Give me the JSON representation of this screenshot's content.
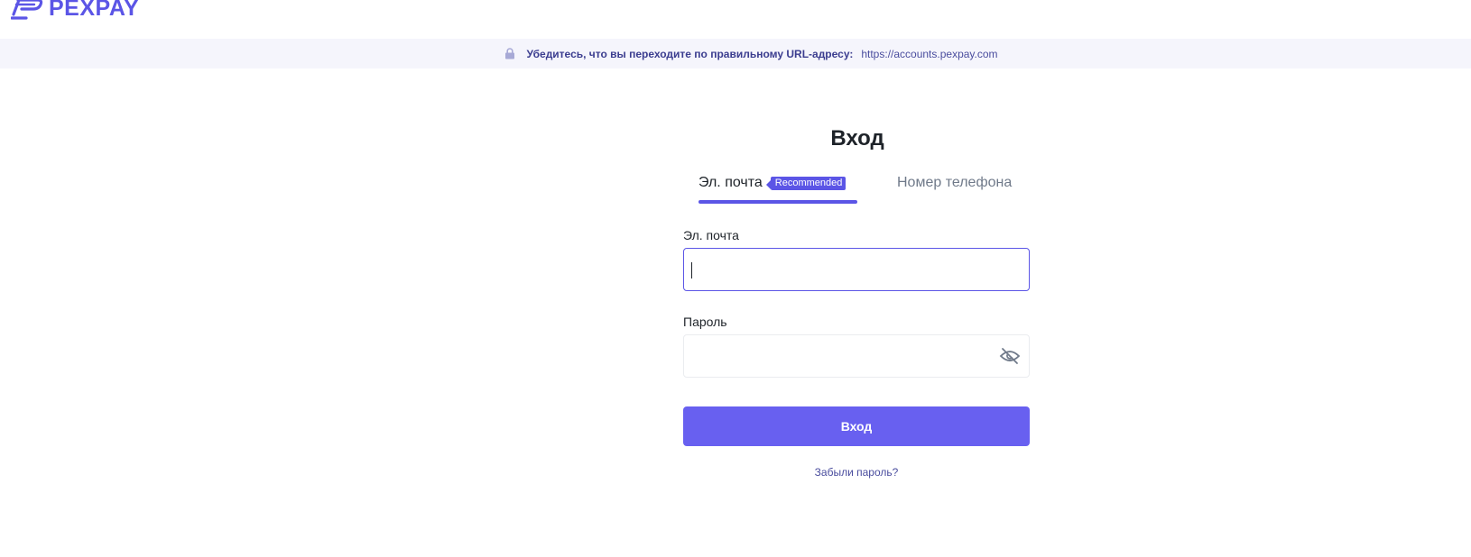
{
  "header": {
    "logo_text": "PEXPAY"
  },
  "url_banner": {
    "warning": "Убедитесь, что вы переходите по правильному URL-адресу:",
    "url": "https://accounts.pexpay.com"
  },
  "login": {
    "title": "Вход",
    "tabs": [
      {
        "label": "Эл. почта",
        "badge": "Recommended",
        "active": true
      },
      {
        "label": "Номер телефона",
        "active": false
      }
    ],
    "email_label": "Эл. почта",
    "email_value": "",
    "password_label": "Пароль",
    "password_value": "",
    "submit_label": "Вход",
    "forgot_label": "Забыли пароль?"
  },
  "colors": {
    "brand": "#5b55e6",
    "button": "#6860f0",
    "banner_bg": "#f5f5fc"
  },
  "icons": [
    "logo-mark-icon",
    "lock-icon",
    "eye-off-icon"
  ]
}
